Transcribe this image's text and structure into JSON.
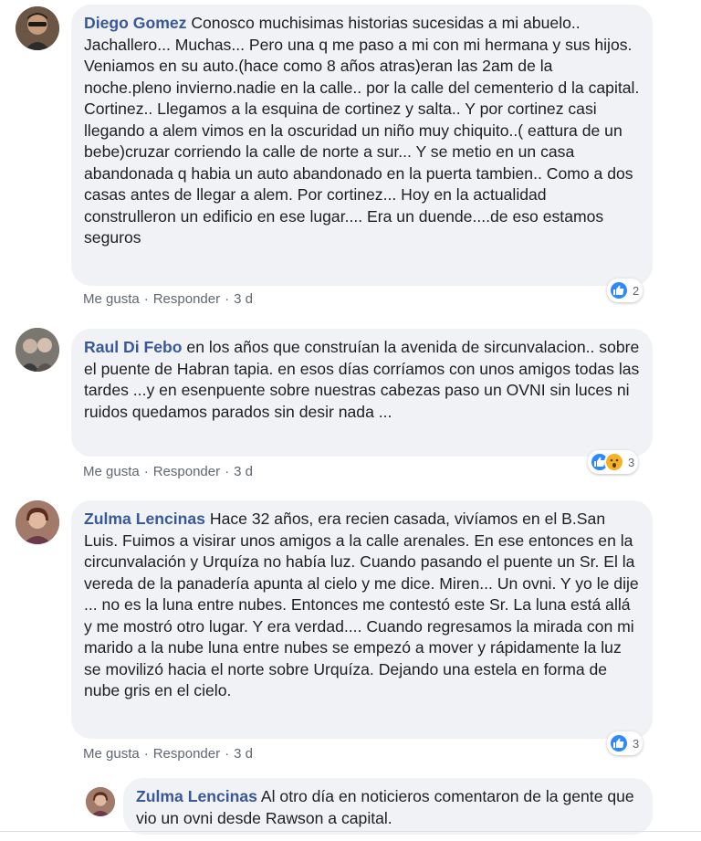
{
  "comments": [
    {
      "author": "Diego Gomez",
      "text": "Conosco muchisimas historias sucesidas a mi abuelo.. Jachallero... Muchas... Pero una q me paso a mi con mi hermana y sus hijos. Veniamos en su auto.(hace como 8 años atras)eran las 2am de la noche.pleno invierno.nadie en la calle.. por la calle del cementerio d la capital. Cortinez.. Llegamos a la esquina de cortinez y salta.. Y por cortinez casi llegando a alem vimos en la oscuridad un niño muy chiquito..( eattura de un bebe)cruzar corriendo la calle de norte a sur... Y se metio en un casa abandonada q habia un auto abandonado en la puerta tambien.. Como a dos casas antes de llegar a alem. Por cortinez... Hoy en la actualidad construlleron un edificio en ese lugar.... Era un duende....de eso estamos seguros",
      "like_label": "Me gusta",
      "reply_label": "Responder",
      "time": "3 d",
      "reaction_count": "2",
      "avatar_icon": "profile-photo-man-sunglasses"
    },
    {
      "author": "Raul Di Febo",
      "text": "en los años que construían la avenida de sircunvalacion.. sobre el puente de Habran tapia. en esos días corríamos con unos amigos todas las tardes ...y en esenpuente sobre nuestras cabezas paso un OVNI sin luces ni ruidos quedamos parados sin desir nada ...",
      "like_label": "Me gusta",
      "reply_label": "Responder",
      "time": "3 d",
      "reaction_count": "3",
      "avatar_icon": "profile-photo-group"
    },
    {
      "author": "Zulma Lencinas",
      "text": "Hace 32 años, era recien casada, vivíamos en el B.San Luis. Fuimos a visirar unos amigos a la calle arenales. En ese entonces en la circunvalación y Urquíza no había luz. Cuando pasando el puente un Sr. El la vereda de la panadería apunta al cielo y me dice. Miren... Un ovni. Y yo le dije ... no es la luna entre nubes. Entonces me contestó este Sr. La luna está allá y me mostró otro lugar. Y era verdad.... Cuando regresamos la mirada con mi marido a la nube luna entre nubes se empezó a mover y rápidamente la luz se movilizó hacia el norte sobre Urquíza. Dejando una estela en forma de nube gris en el cielo.",
      "like_label": "Me gusta",
      "reply_label": "Responder",
      "time": "3 d",
      "reaction_count": "3",
      "avatar_icon": "profile-photo-woman"
    }
  ],
  "reply": {
    "author": "Zulma Lencinas",
    "text": "Al otro día en noticieros comentaron de la gente que vio un ovni desde Rawson a capital.",
    "avatar_icon": "profile-photo-woman"
  },
  "separator": "·",
  "colors": {
    "bubble_bg": "#f0f2f5",
    "author": "#385898",
    "meta": "#606770",
    "like": "#2d88ff",
    "wow": "#f7b125"
  }
}
